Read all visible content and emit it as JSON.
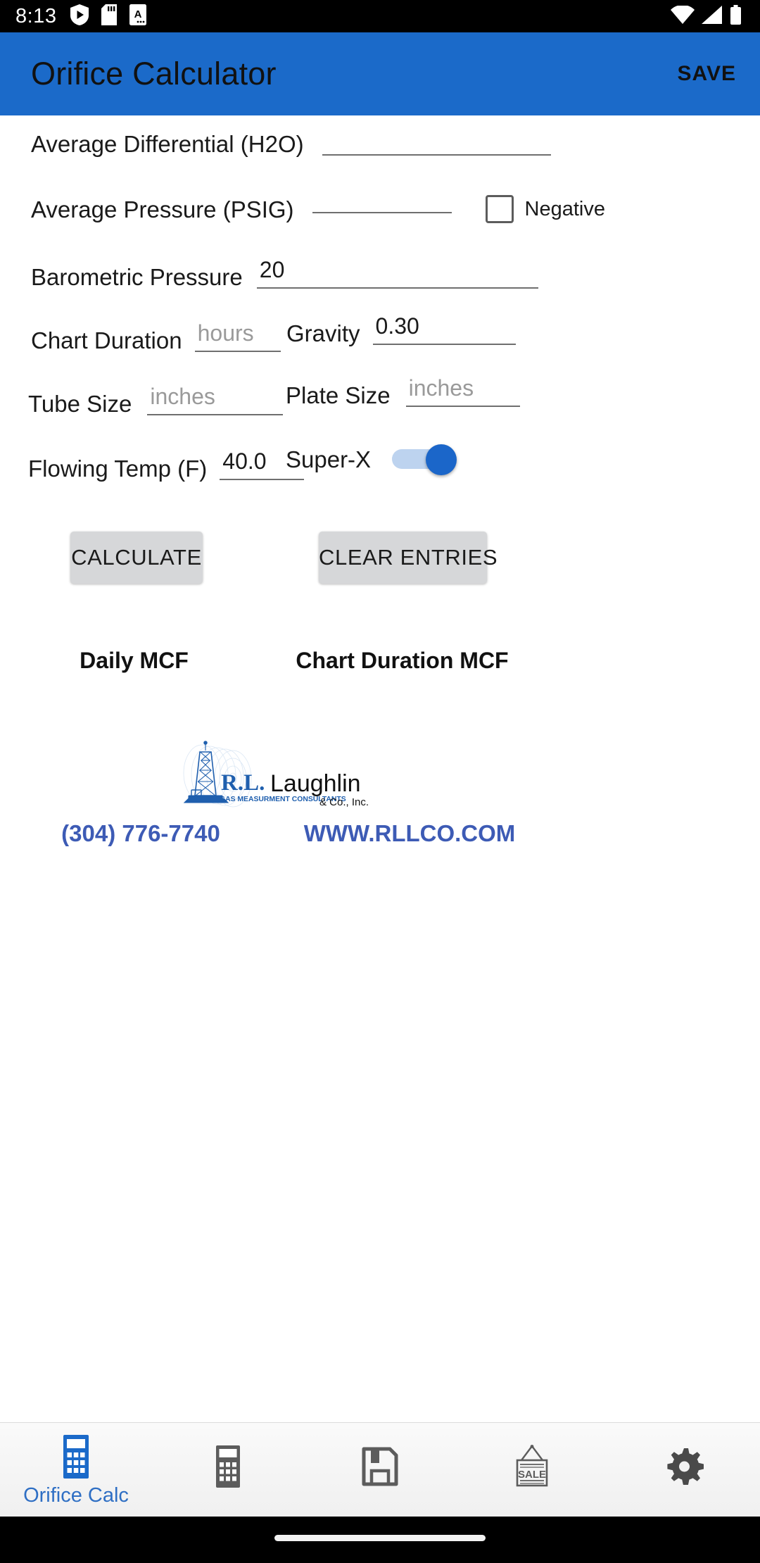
{
  "status_bar": {
    "time": "8:13",
    "left_icons": [
      "play-protect-icon",
      "sd-card-icon",
      "text-document-icon"
    ],
    "right_icons": [
      "wifi-icon",
      "cellular-signal-icon",
      "battery-icon"
    ]
  },
  "app_bar": {
    "title": "Orifice Calculator",
    "save_label": "SAVE",
    "background_color": "#1b6ac9"
  },
  "form": {
    "average_differential": {
      "label": "Average Differential (H2O)",
      "value": "",
      "placeholder": ""
    },
    "average_pressure": {
      "label": "Average Pressure (PSIG)",
      "value": "",
      "placeholder": "",
      "negative_label": "Negative",
      "negative_checked": false
    },
    "barometric_pressure": {
      "label": "Barometric Pressure",
      "value": "20",
      "placeholder": ""
    },
    "chart_duration": {
      "label": "Chart Duration",
      "value": "",
      "placeholder": "hours"
    },
    "gravity": {
      "label": "Gravity",
      "value": "0.30",
      "placeholder": ""
    },
    "tube_size": {
      "label": "Tube Size",
      "value": "",
      "placeholder": "inches"
    },
    "plate_size": {
      "label": "Plate Size",
      "value": "",
      "placeholder": "inches"
    },
    "flowing_temp": {
      "label": "Flowing Temp (F)",
      "value": "40.0",
      "placeholder": ""
    },
    "super_x": {
      "label": "Super-X",
      "enabled": true
    }
  },
  "actions": {
    "calculate_label": "CALCULATE",
    "clear_label": "CLEAR ENTRIES"
  },
  "results": {
    "daily_mcf_label": "Daily MCF",
    "daily_mcf_value": "",
    "chart_duration_mcf_label": "Chart Duration MCF",
    "chart_duration_mcf_value": ""
  },
  "branding": {
    "initials": "R.L.",
    "name": "Laughlin",
    "suffix": "& Co., Inc.",
    "tagline": "GAS MEASURMENT CONSULTANTS",
    "logo_color": "#2a64ae"
  },
  "contact": {
    "phone": "(304) 776-7740",
    "website": "WWW.RLLCO.COM",
    "link_color": "#3d5bb5"
  },
  "bottom_nav": {
    "items": [
      {
        "label": "Orifice Calc",
        "icon": "calculator-icon",
        "active": true
      },
      {
        "label": "",
        "icon": "calculator-icon",
        "active": false
      },
      {
        "label": "",
        "icon": "floppy-disk-save-icon",
        "active": false
      },
      {
        "label": "",
        "icon": "sale-sign-icon",
        "active": false
      },
      {
        "label": "",
        "icon": "gear-settings-icon",
        "active": false
      }
    ],
    "active_color": "#1b6ac9",
    "inactive_color": "#5c5c5c"
  }
}
